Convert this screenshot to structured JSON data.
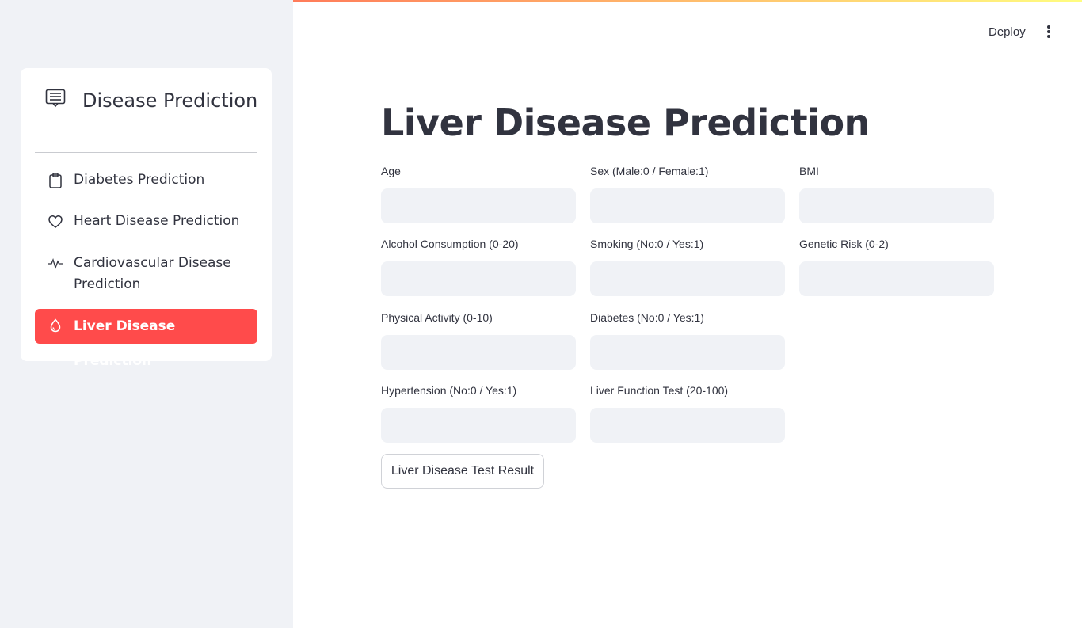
{
  "header": {
    "deploy_label": "Deploy",
    "menu_icon": "vertical-ellipsis-icon"
  },
  "sidebar": {
    "title": "Disease Prediction",
    "title_icon": "card-text-icon",
    "items": [
      {
        "label": "Diabetes Prediction",
        "icon": "clipboard-icon",
        "active": false
      },
      {
        "label": "Heart Disease Prediction",
        "icon": "heart-icon",
        "active": false
      },
      {
        "label": "Cardiovascular Disease Prediction",
        "icon": "activity-icon",
        "active": false
      },
      {
        "label": "Liver Disease Prediction",
        "icon": "droplet-icon",
        "active": true
      }
    ],
    "accent_color": "#ff4b4b"
  },
  "main": {
    "title": "Liver Disease Prediction",
    "fields": [
      {
        "label": "Age",
        "value": ""
      },
      {
        "label": "Sex (Male:0 / Female:1)",
        "value": ""
      },
      {
        "label": "BMI",
        "value": ""
      },
      {
        "label": "Alcohol Consumption (0-20)",
        "value": ""
      },
      {
        "label": "Smoking (No:0 / Yes:1)",
        "value": ""
      },
      {
        "label": "Genetic Risk (0-2)",
        "value": ""
      },
      {
        "label": "Physical Activity (0-10)",
        "value": ""
      },
      {
        "label": "Diabetes (No:0 / Yes:1)",
        "value": ""
      },
      {
        "label": "Hypertension (No:0 / Yes:1)",
        "value": ""
      },
      {
        "label": "Liver Function Test (20-100)",
        "value": ""
      }
    ],
    "submit_label": "Liver Disease Test Result"
  }
}
